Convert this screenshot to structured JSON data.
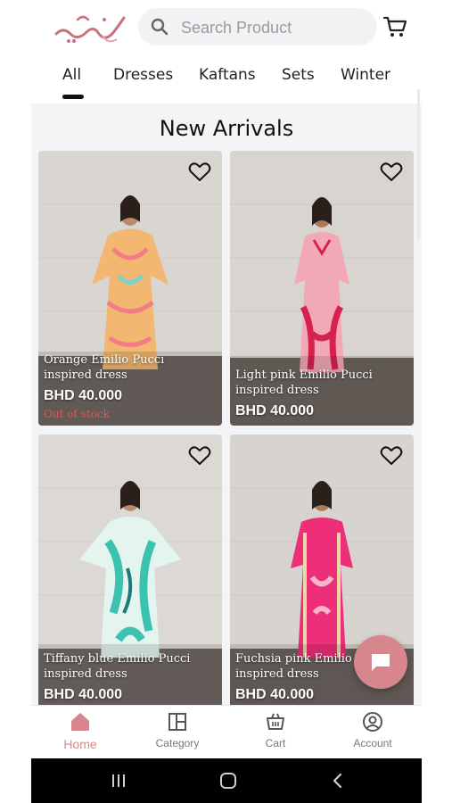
{
  "header": {
    "search_placeholder": "Search Product"
  },
  "tabs": [
    "All",
    "Dresses",
    "Kaftans",
    "Sets",
    "Winter"
  ],
  "section_title": "New Arrivals",
  "products": [
    {
      "name": "Orange Emilio Pucci inspired dress",
      "price": "BHD 40.000",
      "stock": "Out of stock"
    },
    {
      "name": "Light pink Emilio Pucci inspired dress",
      "price": "BHD 40.000",
      "stock": ""
    },
    {
      "name": "Tiffany blue Emilio Pucci inspired dress",
      "price": "BHD 40.000",
      "stock": ""
    },
    {
      "name": "Fuchsia pink Emilio Pucci inspired dress",
      "price": "BHD 40.000",
      "stock": ""
    }
  ],
  "bottom_nav": {
    "home": "Home",
    "category": "Category",
    "cart": "Cart",
    "account": "Account"
  },
  "colors": {
    "accent": "#d7868e",
    "out_of_stock": "#e05555",
    "content_bg": "#f3f4f6"
  },
  "icons": {
    "search": "search-icon",
    "cart": "cart-icon",
    "favorite": "heart-icon",
    "chat": "chat-icon",
    "home": "home-icon",
    "category": "category-icon",
    "account": "account-icon"
  }
}
